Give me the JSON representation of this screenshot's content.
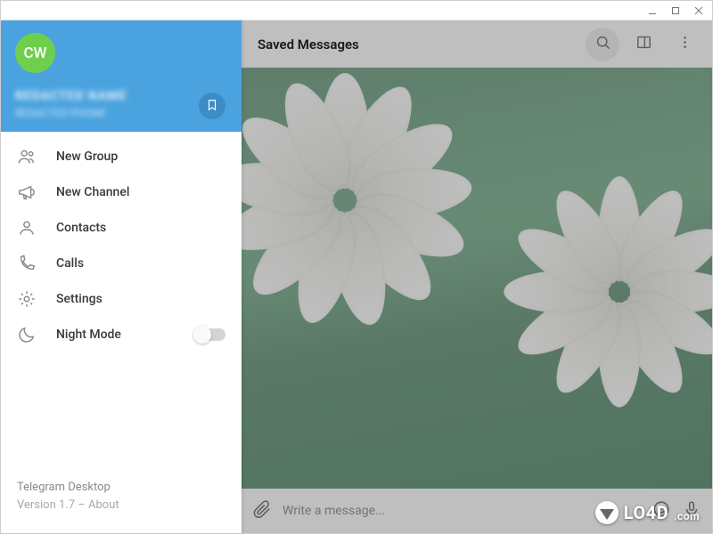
{
  "header": {
    "chat_title": "Saved Messages"
  },
  "profile": {
    "avatar_initials": "CW",
    "display_name": "REDACTED NAME",
    "phone": "REDACTED PHONE"
  },
  "menu": {
    "items": [
      {
        "id": "new-group",
        "label": "New Group"
      },
      {
        "id": "new-channel",
        "label": "New Channel"
      },
      {
        "id": "contacts",
        "label": "Contacts"
      },
      {
        "id": "calls",
        "label": "Calls"
      },
      {
        "id": "settings",
        "label": "Settings"
      },
      {
        "id": "night-mode",
        "label": "Night Mode",
        "toggle": false
      }
    ]
  },
  "footer": {
    "app_name": "Telegram Desktop",
    "version_prefix": "Version ",
    "version": "1.7",
    "separator": " – ",
    "about_label": "About"
  },
  "composer": {
    "placeholder": "Write a message..."
  },
  "watermark": {
    "text": "LO4D",
    "suffix": ".com"
  },
  "colors": {
    "accent": "#4aa3df",
    "avatar": "#6fcf4d"
  }
}
